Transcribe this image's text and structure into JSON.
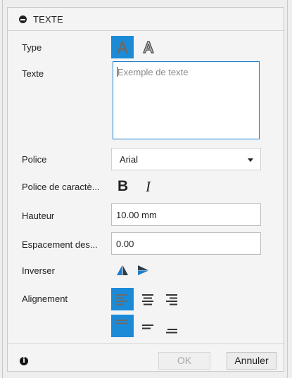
{
  "panel": {
    "title": "TEXTE"
  },
  "fields": {
    "type_label": "Type",
    "text_label": "Texte",
    "text_placeholder": "Exemple de texte",
    "font_label": "Police",
    "font_value": "Arial",
    "style_label": "Police de caractè...",
    "height_label": "Hauteur",
    "height_value": "10.00 mm",
    "spacing_label": "Espacement des...",
    "spacing_value": "0.00",
    "flip_label": "Inverser",
    "align_label": "Alignement"
  },
  "icons": {
    "collapse": "minus-circle-icon",
    "type_filled": "text-filled-icon",
    "type_outline": "text-outline-icon",
    "bold": "bold-icon",
    "italic": "italic-icon",
    "flip_horizontal": "flip-horizontal-icon",
    "flip_vertical": "flip-vertical-icon",
    "align_left": "align-left-icon",
    "align_center": "align-center-icon",
    "align_right": "align-right-icon",
    "valign_top": "align-top-icon",
    "valign_middle": "align-middle-icon",
    "valign_bottom": "align-bottom-icon",
    "info": "info-icon"
  },
  "glyphs": {
    "type_letter": "A",
    "bold_letter": "B",
    "italic_letter": "I",
    "info_letter": "i"
  },
  "footer": {
    "ok_label": "OK",
    "cancel_label": "Annuler"
  },
  "colors": {
    "accent": "#1b8bd8",
    "panel_bg": "#f4f4f4",
    "icon_gray": "#6b6b6b"
  }
}
